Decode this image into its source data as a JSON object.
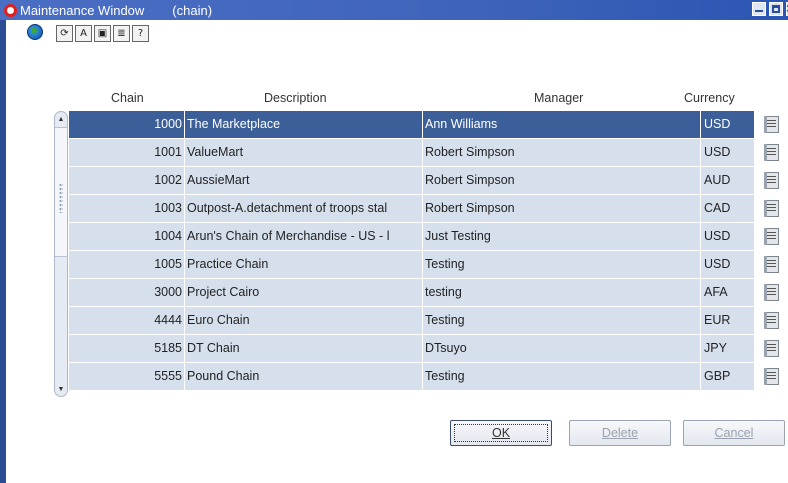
{
  "window": {
    "title": "Maintenance Window",
    "subtitle": "(chain)"
  },
  "toolbar": {
    "icons": [
      "globe-icon",
      "refresh-icon",
      "find-icon",
      "view-icon",
      "notes-icon",
      "help-icon"
    ]
  },
  "table": {
    "headers": {
      "chain": "Chain",
      "description": "Description",
      "manager": "Manager",
      "currency": "Currency"
    },
    "rows": [
      {
        "chain": "1000",
        "description": "The Marketplace",
        "manager": "Ann Williams",
        "currency": "USD",
        "selected": true
      },
      {
        "chain": "1001",
        "description": "ValueMart",
        "manager": "Robert Simpson",
        "currency": "USD"
      },
      {
        "chain": "1002",
        "description": "AussieMart",
        "manager": "Robert Simpson",
        "currency": "AUD"
      },
      {
        "chain": "1003",
        "description": "Outpost-A.detachment of troops stal",
        "manager": "Robert Simpson",
        "currency": "CAD"
      },
      {
        "chain": "1004",
        "description": "Arun's Chain of Merchandise - US - l",
        "manager": "Just Testing",
        "currency": "USD"
      },
      {
        "chain": "1005",
        "description": "Practice Chain",
        "manager": "Testing",
        "currency": "USD"
      },
      {
        "chain": "3000",
        "description": "Project Cairo",
        "manager": "testing",
        "currency": "AFA"
      },
      {
        "chain": "4444",
        "description": "Euro Chain",
        "manager": "Testing",
        "currency": "EUR"
      },
      {
        "chain": "5185",
        "description": "DT Chain",
        "manager": "DTsuyo",
        "currency": "JPY"
      },
      {
        "chain": "5555",
        "description": "Pound Chain",
        "manager": "Testing",
        "currency": "GBP"
      }
    ]
  },
  "buttons": {
    "ok": "OK",
    "delete": "Delete",
    "cancel": "Cancel"
  },
  "colors": {
    "title_bar": "#3e64b9",
    "row_bg": "#d6e0ed",
    "selected_row": "#3c5f99"
  }
}
